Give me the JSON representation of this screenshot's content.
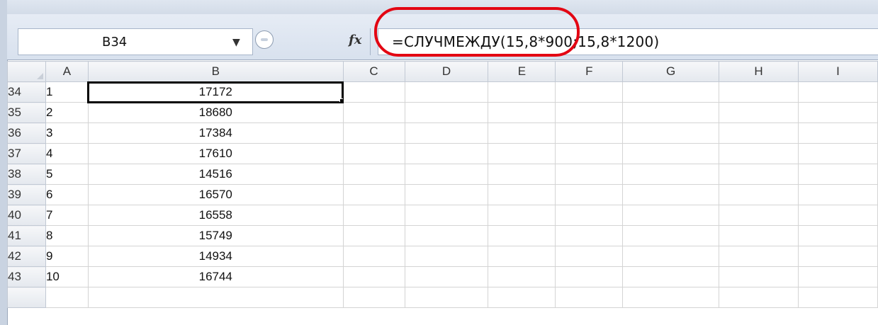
{
  "name_box": {
    "value": "B34"
  },
  "formula_bar": {
    "fx_label": "fx",
    "formula": "=СЛУЧМЕЖДУ(15,8*900;15,8*1200)"
  },
  "columns": [
    "A",
    "B",
    "C",
    "D",
    "E",
    "F",
    "G",
    "H",
    "I"
  ],
  "rows": [
    {
      "row": "34",
      "a": "1",
      "b": "17172"
    },
    {
      "row": "35",
      "a": "2",
      "b": "18680"
    },
    {
      "row": "36",
      "a": "3",
      "b": "17384"
    },
    {
      "row": "37",
      "a": "4",
      "b": "17610"
    },
    {
      "row": "38",
      "a": "5",
      "b": "14516"
    },
    {
      "row": "39",
      "a": "6",
      "b": "16570"
    },
    {
      "row": "40",
      "a": "7",
      "b": "16558"
    },
    {
      "row": "41",
      "a": "8",
      "b": "15749"
    },
    {
      "row": "42",
      "a": "9",
      "b": "14934"
    },
    {
      "row": "43",
      "a": "10",
      "b": "16744"
    }
  ],
  "colors": {
    "selection_header": "#f4c867",
    "annotation_red": "#e30613",
    "grid_line": "#d4d4d4"
  }
}
